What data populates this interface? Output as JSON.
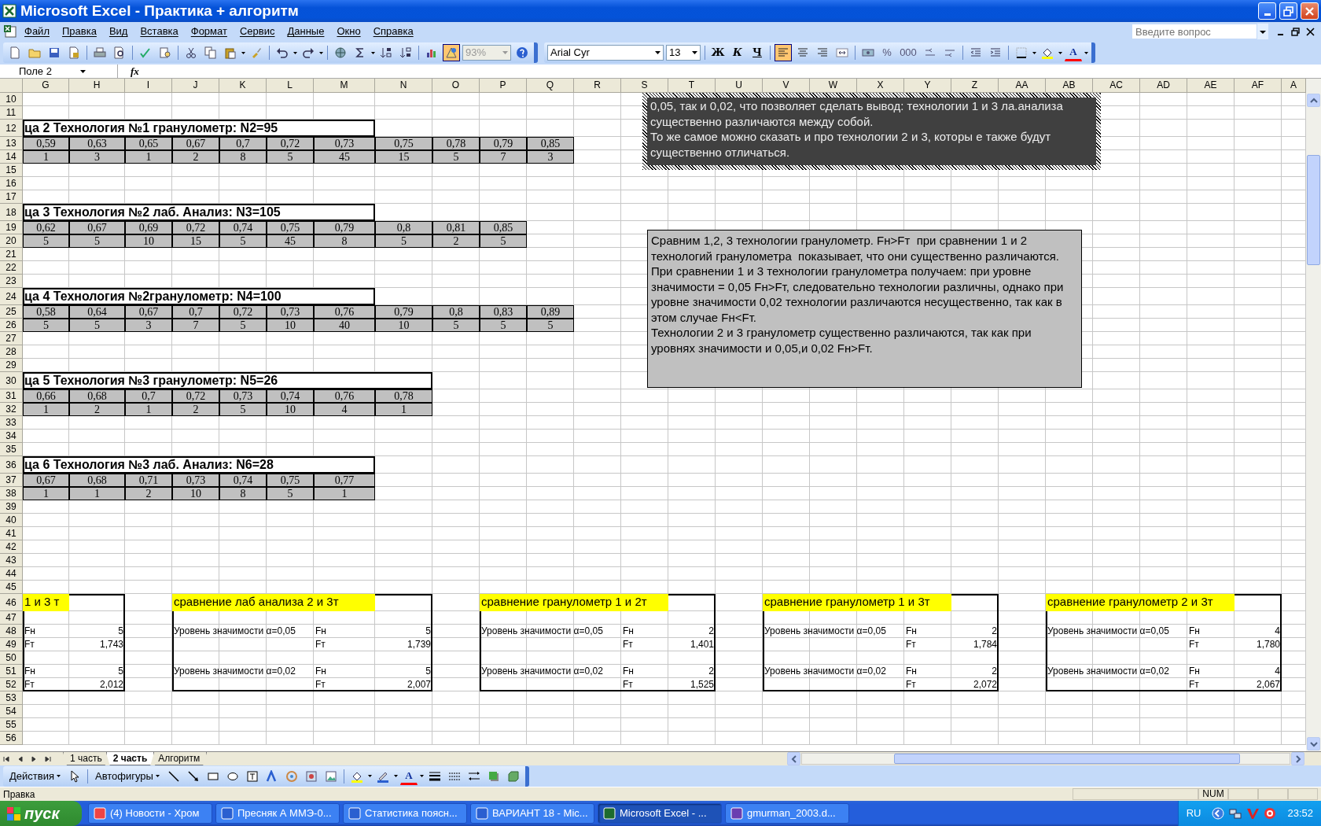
{
  "window": {
    "title": "Microsoft Excel - Практика + алгоритм"
  },
  "menu": [
    "Файл",
    "Правка",
    "Вид",
    "Вставка",
    "Формат",
    "Сервис",
    "Данные",
    "Окно",
    "Справка"
  ],
  "help_box": {
    "placeholder": "Введите вопрос"
  },
  "toolbar": {
    "drawing_toggle_on": true,
    "zoom": {
      "value": "93%",
      "disabled": true
    },
    "font": "Arial Cyr",
    "font_size": "13",
    "style_buttons": [
      {
        "label": "Ж",
        "kind": "bold"
      },
      {
        "label": "К",
        "kind": "italic"
      },
      {
        "label": "Ч",
        "kind": "underline"
      }
    ],
    "align_buttons": [
      {
        "selected": true
      },
      {
        "selected": false
      },
      {
        "selected": false
      }
    ],
    "number_buttons": [
      "%",
      "000"
    ],
    "font_color_label": "A"
  },
  "formula_bar": {
    "name_box": "Поле 2",
    "function_label": "fx"
  },
  "columns": [
    "G",
    "H",
    "I",
    "J",
    "K",
    "L",
    "M",
    "N",
    "O",
    "P",
    "Q",
    "R",
    "S",
    "T",
    "U",
    "V",
    "W",
    "X",
    "Y",
    "Z",
    "AA",
    "AB",
    "AC",
    "AD",
    "AE",
    "AF",
    "A"
  ],
  "row_numbers": [
    "10",
    "11",
    "12",
    "13",
    "14",
    "15",
    "16",
    "17",
    "18",
    "19",
    "20",
    "21",
    "22",
    "23",
    "24",
    "25",
    "26",
    "27",
    "28",
    "29",
    "30",
    "31",
    "32",
    "33",
    "34",
    "35",
    "36",
    "37",
    "38",
    "39",
    "40",
    "41",
    "42",
    "43",
    "44",
    "45",
    "46",
    "47",
    "48",
    "49",
    "50",
    "51",
    "52",
    "53",
    "54",
    "55",
    "56"
  ],
  "tables": [
    {
      "title": "ца  2 Технология №1 гранулометр: N2=95",
      "values": [
        "0,59",
        "0,63",
        "0,65",
        "0,67",
        "0,7",
        "0,72",
        "0,73",
        "0,75",
        "0,78",
        "0,79",
        "0,85"
      ],
      "counts": [
        "1",
        "3",
        "1",
        "2",
        "8",
        "5",
        "45",
        "15",
        "5",
        "7",
        "3"
      ]
    },
    {
      "title": "ца  3  Технология №2 лаб. Анализ: N3=105",
      "values": [
        "0,62",
        "0,67",
        "0,69",
        "0,72",
        "0,74",
        "0,75",
        "0,79",
        "0,8",
        "0,81",
        "0,85"
      ],
      "counts": [
        "5",
        "5",
        "10",
        "15",
        "5",
        "45",
        "8",
        "5",
        "2",
        "5"
      ]
    },
    {
      "title": "ца  4 Технология №2гранулометр: N4=100",
      "values": [
        "0,58",
        "0,64",
        "0,67",
        "0,7",
        "0,72",
        "0,73",
        "0,76",
        "0,79",
        "0,8",
        "0,83",
        "0,89"
      ],
      "counts": [
        "5",
        "5",
        "3",
        "7",
        "5",
        "10",
        "40",
        "10",
        "5",
        "5",
        "5"
      ]
    },
    {
      "title": "ца  5 Технология №3 гранулометр: N5=26",
      "values": [
        "0,66",
        "0,68",
        "0,7",
        "0,72",
        "0,73",
        "0,74",
        "0,76",
        "0,78"
      ],
      "counts": [
        "1",
        "2",
        "1",
        "2",
        "5",
        "10",
        "4",
        "1"
      ]
    },
    {
      "title": "ца  6 Технология №3 лаб. Анализ: N6=28",
      "values": [
        "0,67",
        "0,68",
        "0,71",
        "0,73",
        "0,74",
        "0,75",
        "0,77"
      ],
      "counts": [
        "1",
        "1",
        "2",
        "10",
        "8",
        "5",
        "1"
      ]
    }
  ],
  "comparisons": [
    {
      "title": "1 и 3 т",
      "levels": [
        {
          "fn_label": "Fн",
          "fn": "5",
          "ft_label": "Fт",
          "ft": "1,743"
        },
        {
          "fn_label": "Fн",
          "fn": "5",
          "ft_label": "Fт",
          "ft": "2,012"
        }
      ]
    },
    {
      "title": "сравнение лаб анализа 2 и 3т",
      "levels": [
        {
          "level": "Уровень значимости α=0,05",
          "fn_label": "Fн",
          "fn": "5",
          "ft_label": "Fт",
          "ft": "1,739"
        },
        {
          "level": "Уровень значимости α=0,02",
          "fn_label": "Fн",
          "fn": "5",
          "ft_label": "Fт",
          "ft": "2,007"
        }
      ]
    },
    {
      "title": "сравнение гранулометр 1 и 2т",
      "levels": [
        {
          "level": "Уровень значимости α=0,05",
          "fn_label": "Fн",
          "fn": "2",
          "ft_label": "Fт",
          "ft": "1,401"
        },
        {
          "level": "Уровень значимости α=0,02",
          "fn_label": "Fн",
          "fn": "2",
          "ft_label": "Fт",
          "ft": "1,525"
        }
      ]
    },
    {
      "title": "сравнение гранулометр 1 и 3т",
      "levels": [
        {
          "level": "Уровень значимости α=0,05",
          "fn_label": "Fн",
          "fn": "2",
          "ft_label": "Fт",
          "ft": "1,784"
        },
        {
          "level": "Уровень значимости α=0,02",
          "fn_label": "Fн",
          "fn": "2",
          "ft_label": "Fт",
          "ft": "2,072"
        }
      ]
    },
    {
      "title": "сравнение гранулометр 2 и 3т",
      "levels": [
        {
          "level": "Уровень значимости α=0,05",
          "fn_label": "Fн",
          "fn": "4",
          "ft_label": "Fт",
          "ft": "1,780"
        },
        {
          "level": "Уровень значимости α=0,02",
          "fn_label": "Fн",
          "fn": "4",
          "ft_label": "Fт",
          "ft": "2,067"
        }
      ]
    }
  ],
  "text_boxes": [
    {
      "kind": "dark",
      "selected": true,
      "paragraphs": [
        "0,05, так и 0,02, что позволяет сделать вывод: технологии 1 и 3 ла.анализа существенно различаются между собой.",
        "То же самое можно сказать и про технологии 2 и 3, которы е также будут существенно отличаться."
      ]
    },
    {
      "kind": "light",
      "selected": false,
      "paragraphs": [
        "Сравним 1,2, 3 технологии гранулометр. Fн>Fт  при сравнении 1 и 2 технологий гранулометра  показывает, что они существенно различаются.",
        "При сравнении 1 и 3 технологии гранулометра получаем: при уровне значимости = 0,05 Fн>Fт, следовательно технологии различны, однако при уровне значимости 0,02 технологии различаются несущественно, так как в этом случае Fн<Fт.",
        "Технологии 2 и 3 гранулометр существенно различаются, так как при уровнях значимости и 0,05,и 0,02 Fн>Fт."
      ]
    }
  ],
  "sheet_tabs": [
    {
      "label": "1 часть",
      "selected": false
    },
    {
      "label": "2 часть",
      "selected": true
    },
    {
      "label": "Алгоритм",
      "selected": false
    }
  ],
  "drawing_toolbar": {
    "actions": "Действия",
    "autoshapes": "Автофигуры",
    "font_color_label": "A"
  },
  "status_bar": {
    "mode": "Правка",
    "indicators": [
      "NUM"
    ]
  },
  "taskbar": {
    "start": "пуск",
    "tasks": [
      {
        "label": "(4) Новости - Хром",
        "selected": false
      },
      {
        "label": "Пресняк А ММЭ-0...",
        "selected": false
      },
      {
        "label": "Статистика поясн...",
        "selected": false
      },
      {
        "label": "ВАРИАНТ 18 - Mic...",
        "selected": false
      },
      {
        "label": "Microsoft Excel - ...",
        "selected": true
      },
      {
        "label": "gmurman_2003.d...",
        "selected": false
      }
    ],
    "language": "RU",
    "clock": "23:52"
  }
}
